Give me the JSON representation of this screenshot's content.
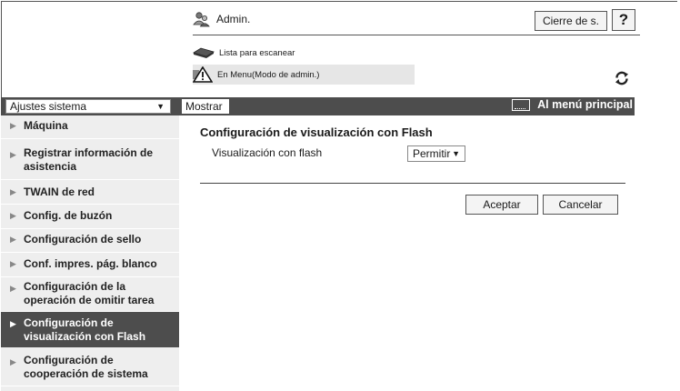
{
  "header": {
    "user_label": "Admin.",
    "logout_label": "Cierre de s.",
    "help_label": "?",
    "scan_list_label": "Lista para escanear",
    "menu_status_label": "En Menu(Modo de admin.)"
  },
  "toolbar": {
    "system_select_value": "Ajustes sistema",
    "show_label": "Mostrar",
    "main_menu_label": "Al menú principal"
  },
  "sidebar": {
    "items": [
      {
        "label": "Máquina",
        "active": false
      },
      {
        "label": "Registrar información de asistencia",
        "active": false
      },
      {
        "label": "TWAIN de red",
        "active": false
      },
      {
        "label": "Config. de buzón",
        "active": false
      },
      {
        "label": "Configuración de sello",
        "active": false
      },
      {
        "label": "Conf. impres. pág. blanco",
        "active": false
      },
      {
        "label": "Configuración de la operación de omitir tarea",
        "active": false
      },
      {
        "label": "Configuración de visualización con Flash",
        "active": true
      },
      {
        "label": "Configuración de cooperación de sistema",
        "active": false
      }
    ]
  },
  "main": {
    "section_title": "Configuración de visualización con Flash",
    "field_label": "Visualización con flash",
    "field_value": "Permitir",
    "accept_label": "Aceptar",
    "cancel_label": "Cancelar"
  },
  "colors": {
    "dark_bar": "#4d4d4d",
    "sidebar_bg": "#eeeeee",
    "active_item": "#4d4d4d"
  }
}
